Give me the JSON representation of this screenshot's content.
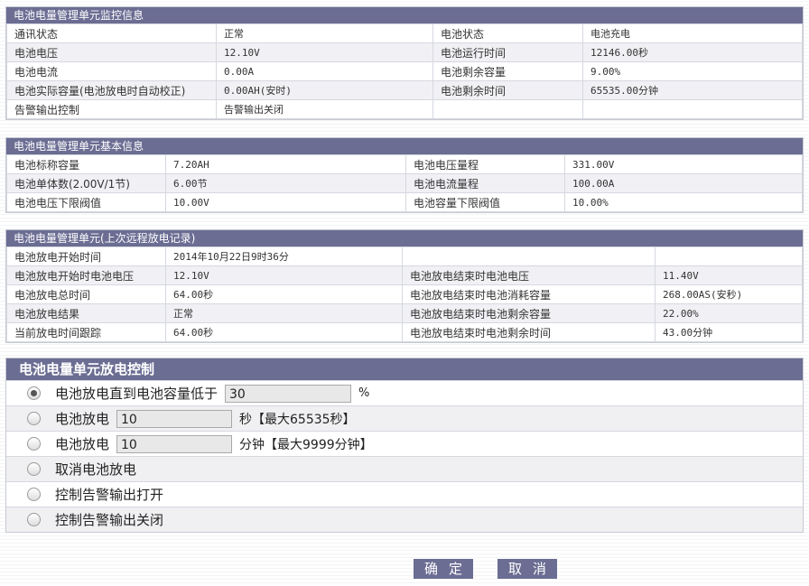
{
  "monitor": {
    "title": "电池电量管理单元监控信息",
    "rows": [
      [
        "通讯状态",
        "正常",
        "电池状态",
        "电池充电"
      ],
      [
        "电池电压",
        "12.10V",
        "电池运行时间",
        "12146.00秒"
      ],
      [
        "电池电流",
        "0.00A",
        "电池剩余容量",
        "9.00%"
      ],
      [
        "电池实际容量(电池放电时自动校正)",
        "0.00AH(安时)",
        "电池剩余时间",
        "65535.00分钟"
      ],
      [
        "告警输出控制",
        "告警输出关闭",
        "",
        ""
      ]
    ]
  },
  "basic": {
    "title": "电池电量管理单元基本信息",
    "rows": [
      [
        "电池标称容量",
        "7.20AH",
        "电池电压量程",
        "331.00V"
      ],
      [
        "电池单体数(2.00V/1节)",
        "6.00节",
        "电池电流量程",
        "100.00A"
      ],
      [
        "电池电压下限阀值",
        "10.00V",
        "电池容量下限阀值",
        "10.00%"
      ]
    ]
  },
  "record": {
    "title": "电池电量管理单元(上次远程放电记录)",
    "rows": [
      [
        "电池放电开始时间",
        "2014年10月22日9时36分",
        "",
        ""
      ],
      [
        "电池放电开始时电池电压",
        "12.10V",
        "电池放电结束时电池电压",
        "11.40V"
      ],
      [
        "电池放电总时间",
        "64.00秒",
        "电池放电结束时电池消耗容量",
        "268.00AS(安秒)"
      ],
      [
        "电池放电结果",
        "正常",
        "电池放电结束时电池剩余容量",
        "22.00%"
      ],
      [
        "当前放电时间跟踪",
        "64.00秒",
        "电池放电结束时电池剩余时间",
        "43.00分钟"
      ]
    ]
  },
  "control": {
    "title": "电池电量单元放电控制",
    "opt1_label": "电池放电直到电池容量低于",
    "opt1_value": "30",
    "opt1_unit": "%",
    "opt2_label": "电池放电",
    "opt2_value": "10",
    "opt2_unit": "秒【最大65535秒】",
    "opt3_label": "电池放电",
    "opt3_value": "10",
    "opt3_unit": "分钟【最大9999分钟】",
    "opt4_label": "取消电池放电",
    "opt5_label": "控制告警输出打开",
    "opt6_label": "控制告警输出关闭"
  },
  "buttons": {
    "ok": "确定",
    "cancel": "取消"
  }
}
